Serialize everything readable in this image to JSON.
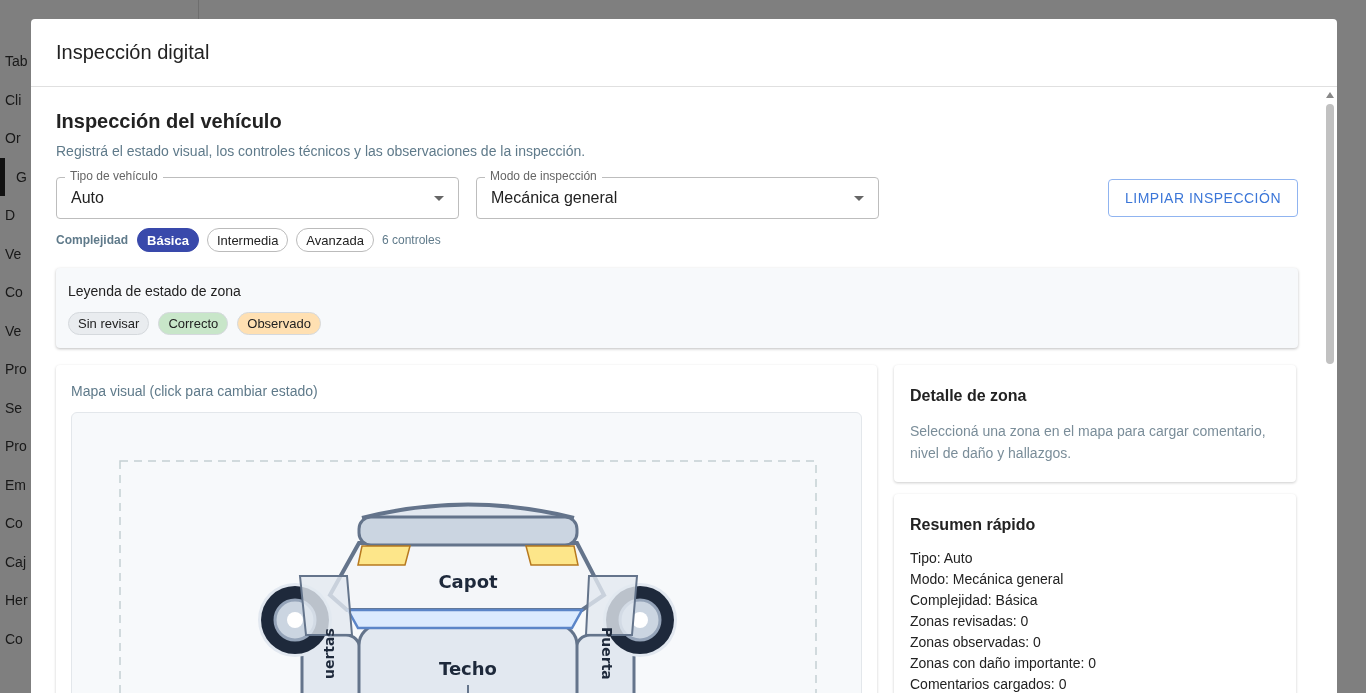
{
  "background_sidebar": {
    "items": [
      {
        "label": "Tab",
        "selected": false
      },
      {
        "label": "Cli",
        "selected": false
      },
      {
        "label": "Or",
        "selected": false
      },
      {
        "label": "G",
        "selected": true
      },
      {
        "label": "D",
        "selected": false
      },
      {
        "label": "Ve",
        "selected": false
      },
      {
        "label": "Co",
        "selected": false
      },
      {
        "label": "Ve",
        "selected": false
      },
      {
        "label": "Pro",
        "selected": false
      },
      {
        "label": "Se",
        "selected": false
      },
      {
        "label": "Pro",
        "selected": false
      },
      {
        "label": "Em",
        "selected": false
      },
      {
        "label": "Co",
        "selected": false
      },
      {
        "label": "Caj",
        "selected": false
      },
      {
        "label": "Her",
        "selected": false
      },
      {
        "label": "Co",
        "selected": false
      }
    ]
  },
  "dialog": {
    "title": "Inspección digital",
    "heading": "Inspección del vehículo",
    "subtitle": "Registrá el estado visual, los controles técnicos y las observaciones de la inspección.",
    "fields": [
      {
        "label": "Tipo de vehículo",
        "value": "Auto"
      },
      {
        "label": "Modo de inspección",
        "value": "Mecánica general"
      }
    ],
    "clear_button": "LIMPIAR INSPECCIÓN",
    "complexity": {
      "label": "Complejidad",
      "options": [
        {
          "label": "Básica",
          "selected": true
        },
        {
          "label": "Intermedia",
          "selected": false
        },
        {
          "label": "Avanzada",
          "selected": false
        }
      ],
      "count": "6 controles"
    },
    "legend": {
      "title": "Leyenda de estado de zona",
      "items": [
        {
          "label": "Sin revisar",
          "color": "#e9ecef"
        },
        {
          "label": "Correcto",
          "color": "#c8e6c9"
        },
        {
          "label": "Observado",
          "color": "#ffe0b2"
        }
      ]
    },
    "map": {
      "title": "Mapa visual (click para cambiar estado)",
      "zones": [
        {
          "label": "Capot",
          "kind": "hood"
        },
        {
          "label": "Techo",
          "kind": "roof"
        },
        {
          "label": "uertas",
          "kind": "left-doors"
        },
        {
          "label": "Puerta",
          "kind": "right-doors"
        }
      ]
    },
    "detail": {
      "title": "Detalle de zona",
      "text": "Seleccioná una zona en el mapa para cargar comentario, nivel de daño y hallazgos."
    },
    "summary": {
      "title": "Resumen rápido",
      "lines": [
        "Tipo: Auto",
        "Modo: Mecánica general",
        "Complejidad: Básica",
        "Zonas revisadas: 0",
        "Zonas observadas: 0",
        "Zonas con daño importante: 0",
        "Comentarios cargados: 0"
      ]
    }
  }
}
